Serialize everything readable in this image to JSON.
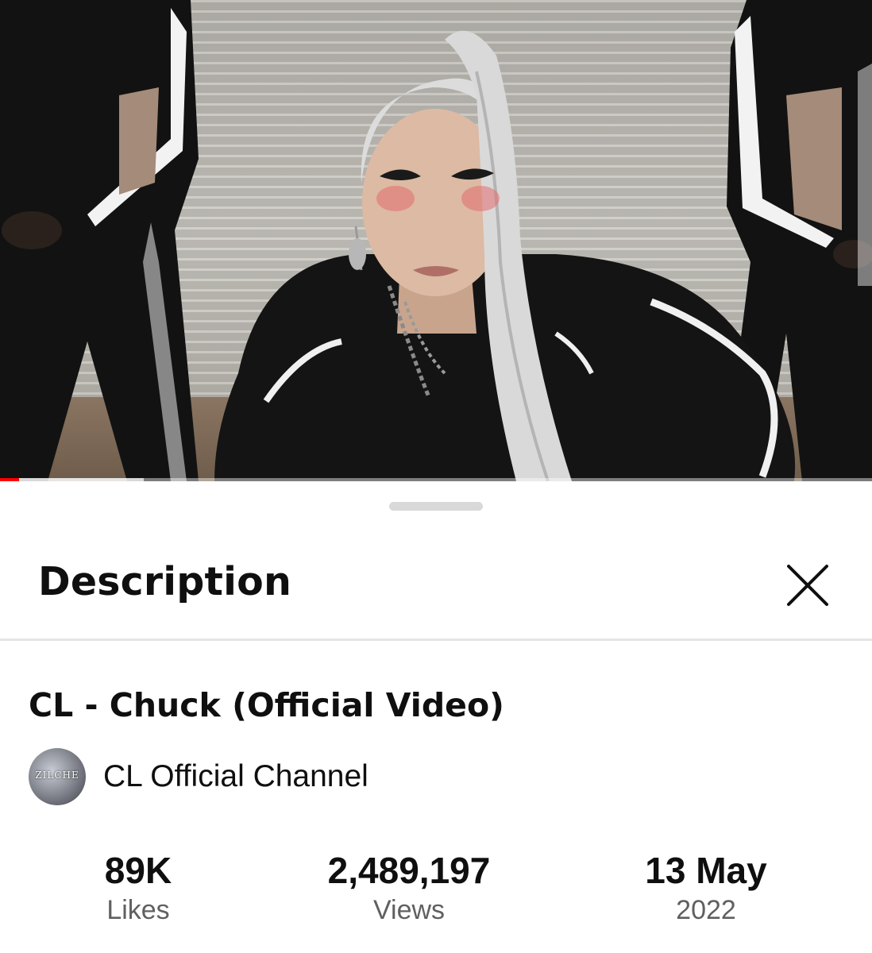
{
  "video": {
    "progress_played": 0.022,
    "progress_buffered": 0.165
  },
  "panel": {
    "title": "Description",
    "close_icon": "close-icon"
  },
  "details": {
    "video_title": "CL - Chuck (Official Video)",
    "channel_name": "CL Official Channel",
    "avatar_text": "ZILCHE"
  },
  "stats": {
    "likes": {
      "value": "89K",
      "label": "Likes"
    },
    "views": {
      "value": "2,489,197",
      "label": "Views"
    },
    "date": {
      "value": "13 May",
      "label": "2022"
    }
  },
  "colors": {
    "progress": "#ff0000",
    "secondary_text": "#606060"
  }
}
